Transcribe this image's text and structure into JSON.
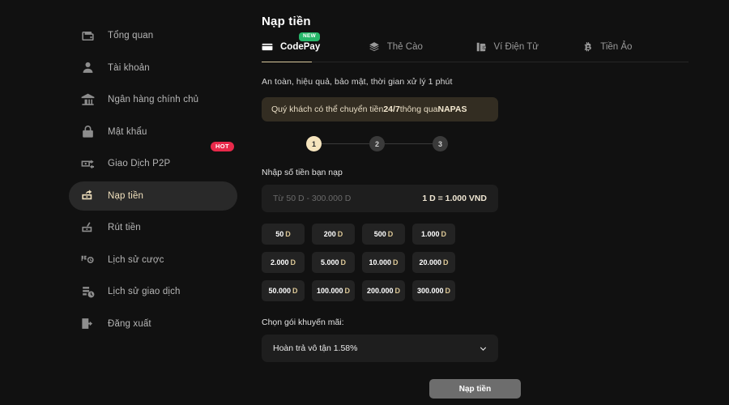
{
  "sidebar": {
    "items": [
      {
        "label": "Tổng quan",
        "icon": "dashboard-icon",
        "active": false,
        "badge": null
      },
      {
        "label": "Tài khoản",
        "icon": "user-icon",
        "active": false,
        "badge": null
      },
      {
        "label": "Ngân hàng chính chủ",
        "icon": "bank-icon",
        "active": false,
        "badge": null
      },
      {
        "label": "Mật khẩu",
        "icon": "lock-icon",
        "active": false,
        "badge": null
      },
      {
        "label": "Giao Dịch P2P",
        "icon": "p2p-exchange-icon",
        "active": false,
        "badge": "HOT"
      },
      {
        "label": "Nạp tiền",
        "icon": "deposit-icon",
        "active": true,
        "badge": null
      },
      {
        "label": "Rút tiền",
        "icon": "withdraw-icon",
        "active": false,
        "badge": null
      },
      {
        "label": "Lịch sử cược",
        "icon": "bet-history-icon",
        "active": false,
        "badge": null
      },
      {
        "label": "Lịch sử giao dịch",
        "icon": "transaction-history-icon",
        "active": false,
        "badge": null
      },
      {
        "label": "Đăng xuất",
        "icon": "logout-icon",
        "active": false,
        "badge": null
      }
    ]
  },
  "main": {
    "title": "Nạp tiền",
    "tabs": [
      {
        "label": "CodePay",
        "icon": "credit-card-icon",
        "active": true,
        "badge": "NEW"
      },
      {
        "label": "Thẻ Cào",
        "icon": "scratch-card-icon",
        "active": false,
        "badge": null
      },
      {
        "label": "Ví Điện Tử",
        "icon": "e-wallet-icon",
        "active": false,
        "badge": null
      },
      {
        "label": "Tiền Ảo",
        "icon": "bitcoin-icon",
        "active": false,
        "badge": null
      }
    ],
    "tagline": "An toàn, hiệu quả, bảo mật, thời gian xử lý 1 phút",
    "banner": {
      "prefix": "Quý khách có thể chuyển tiền ",
      "highlight1": "24/7",
      "middle": " thông qua ",
      "highlight2": "NAPAS"
    },
    "steps": [
      {
        "number": "1",
        "active": true
      },
      {
        "number": "2",
        "active": false
      },
      {
        "number": "3",
        "active": false
      }
    ],
    "amount_section": {
      "label": "Nhập số tiền bạn nạp",
      "placeholder": "Từ 50 D - 300.000 D",
      "value": "",
      "rate": "1 D = 1.000 VND"
    },
    "quick_amounts": [
      {
        "amount": "50",
        "unit": "D"
      },
      {
        "amount": "200",
        "unit": "D"
      },
      {
        "amount": "500",
        "unit": "D"
      },
      {
        "amount": "1.000",
        "unit": "D"
      },
      {
        "amount": "2.000",
        "unit": "D"
      },
      {
        "amount": "5.000",
        "unit": "D"
      },
      {
        "amount": "10.000",
        "unit": "D"
      },
      {
        "amount": "20.000",
        "unit": "D"
      },
      {
        "amount": "50.000",
        "unit": "D"
      },
      {
        "amount": "100.000",
        "unit": "D"
      },
      {
        "amount": "200.000",
        "unit": "D"
      },
      {
        "amount": "300.000",
        "unit": "D"
      }
    ],
    "promo": {
      "label": "Chọn gói khuyến mãi:",
      "selected": "Hoàn trả vô tận 1.58%"
    },
    "submit_label": "Nạp tiền"
  },
  "colors": {
    "background": "#111111",
    "accent_gold": "#f0e0bd",
    "badge_hot": "#e8294a",
    "badge_new": "#27b76a",
    "banner_bg": "#332d22",
    "submit_bg": "#6d6d6d"
  }
}
